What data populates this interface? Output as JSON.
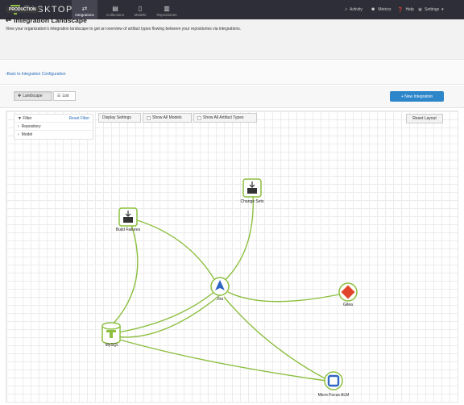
{
  "brand": {
    "name": "TASKTOP"
  },
  "nav": {
    "tabs": [
      {
        "label": "Integrations"
      },
      {
        "label": "Collections"
      },
      {
        "label": "Models"
      },
      {
        "label": "Repositories"
      }
    ],
    "right": [
      {
        "label": "Activity",
        "icon": "bell-icon"
      },
      {
        "label": "Metrics",
        "icon": "people-icon"
      },
      {
        "label": "Help",
        "icon": "help-icon"
      },
      {
        "label": "Settings",
        "icon": "gear-icon"
      }
    ]
  },
  "header": {
    "environment": "PRODUCTION",
    "title": "Integration Landscape",
    "subtitle": "View your organization's integration landscape to get an overview of artifact types flowing between your repositories via integrations."
  },
  "back_link": "Back to Integration Configuration",
  "toolbar": {
    "view_landscape": "Landscape",
    "view_list": "List",
    "new_integration": "+ New Integration"
  },
  "filter": {
    "title": "Filter",
    "reset": "Reset Filter",
    "items": [
      "Repository",
      "Model"
    ]
  },
  "display": {
    "settings": "Display Settings",
    "show_models": "Show All Models",
    "show_artifacts": "Show All Artifact Types",
    "reset_layout": "Reset Layout"
  },
  "graph": {
    "nodes": {
      "change_sets": "Change Sets",
      "build_failures": "Build Failures",
      "jira": "Jira",
      "gitea": "Gitea",
      "mysql": "MySQL",
      "micro_focus": "Micro Focus ALM"
    },
    "edge_color": "#8cbf3f",
    "accent": "#2c86c9"
  }
}
